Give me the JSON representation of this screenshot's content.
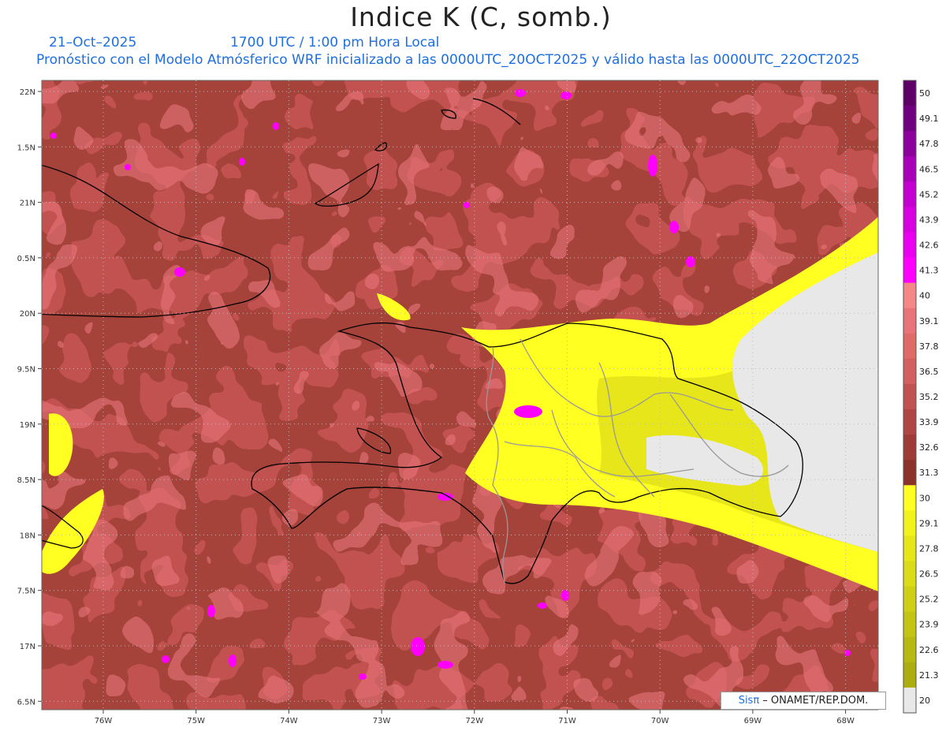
{
  "header": {
    "title": "Indice K (C, somb.)",
    "date": "21–Oct–2025",
    "time": "1700 UTC / 1:00 pm Hora Local",
    "description": "Pronóstico con el Modelo Atmósferico WRF inicializado a las 0000UTC_20OCT2025 y válido hasta las  0000UTC_22OCT2025"
  },
  "map": {
    "lat_labels": [
      "22N",
      "1.5N",
      "21N",
      "0.5N",
      "20N",
      "9.5N",
      "19N",
      "8.5N",
      "18N",
      "7.5N",
      "17N",
      "6.5N"
    ],
    "lon_labels": [
      "76W",
      "75W",
      "74W",
      "73W",
      "72W",
      "71W",
      "70W",
      "69W",
      "68W"
    ]
  },
  "colorbar": {
    "levels": [
      "50",
      "49.1",
      "47.8",
      "46.5",
      "45.2",
      "43.9",
      "42.6",
      "41.3",
      "40",
      "39.1",
      "37.8",
      "36.5",
      "35.2",
      "33.9",
      "32.6",
      "31.3",
      "30",
      "29.1",
      "27.8",
      "26.5",
      "25.2",
      "23.9",
      "22.6",
      "21.3",
      "20"
    ],
    "colors": [
      "#5e0068",
      "#70007f",
      "#8c009c",
      "#a800b8",
      "#c400d0",
      "#d800e0",
      "#ea00ee",
      "#ff00ff",
      "#f48888",
      "#e8747a",
      "#df6a68",
      "#d35f5e",
      "#c25250",
      "#b04643",
      "#9e3b36",
      "#8c3329",
      "#ffff22",
      "#f2f21c",
      "#e6e61a",
      "#dbdb18",
      "#cfcf16",
      "#c4c414",
      "#b8b812",
      "#adad10",
      "#e8e8e8"
    ]
  },
  "credit": {
    "brand": "Sisπ",
    "text": " – ONAMET/REP.DOM."
  }
}
